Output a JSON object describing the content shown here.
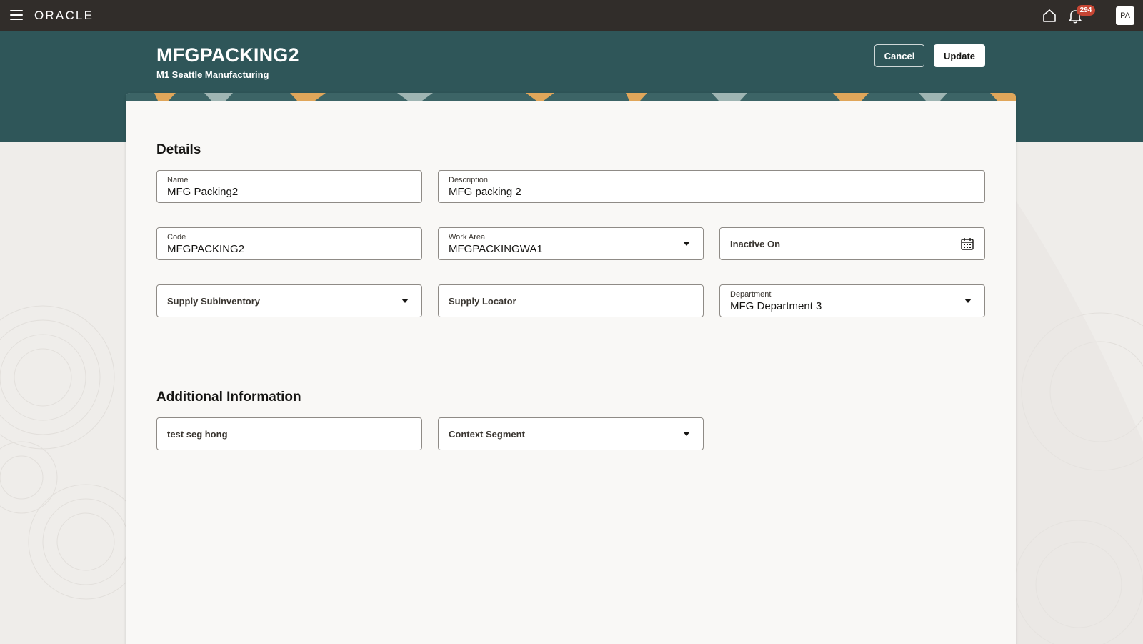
{
  "header": {
    "logo": "ORACLE",
    "notifications_count": "294",
    "avatar_initials": "PA"
  },
  "page": {
    "title": "MFGPACKING2",
    "subtitle": "M1 Seattle Manufacturing",
    "cancel_label": "Cancel",
    "update_label": "Update"
  },
  "details": {
    "section_title": "Details",
    "name": {
      "label": "Name",
      "value": "MFG Packing2"
    },
    "description": {
      "label": "Description",
      "value": "MFG packing 2"
    },
    "code": {
      "label": "Code",
      "value": "MFGPACKING2"
    },
    "work_area": {
      "label": "Work Area",
      "value": "MFGPACKINGWA1"
    },
    "inactive_on": {
      "label": "Inactive On"
    },
    "supply_subinventory": {
      "label": "Supply Subinventory"
    },
    "supply_locator": {
      "label": "Supply Locator"
    },
    "department": {
      "label": "Department",
      "value": "MFG Department 3"
    }
  },
  "additional": {
    "section_title": "Additional Information",
    "test_seg": {
      "label": "test seg hong"
    },
    "context_segment": {
      "label": "Context Segment"
    }
  },
  "colors": {
    "topbar": "#312d2a",
    "band": "#2f5659",
    "badge": "#c74634",
    "card": "#f9f8f6"
  }
}
